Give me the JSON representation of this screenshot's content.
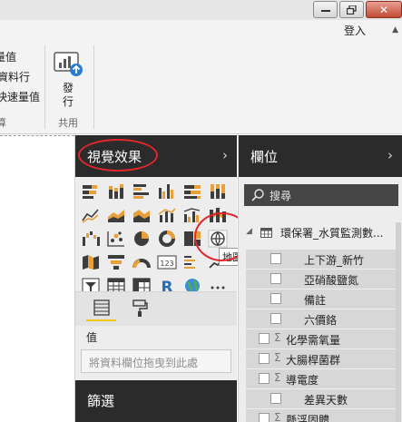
{
  "window": {
    "controls": [
      "minimize",
      "maximize",
      "close"
    ],
    "close_glyph": "✕"
  },
  "ribbon": {
    "signin": "登入",
    "partial_items": [
      "量值",
      "資料行",
      "快速量值"
    ],
    "publish_label": "發行",
    "group_label_left": "算",
    "group_label_share": "共用"
  },
  "visualizations": {
    "title": "視覺效果",
    "chevron": "›",
    "tooltip": "地圖",
    "values_label": "值",
    "drop_placeholder": "將資料欄位拖曳到此處",
    "filter_title": "篩選",
    "icons": [
      "stacked-bar-icon",
      "stacked-column-icon",
      "clustered-bar-icon",
      "clustered-column-icon",
      "100pct-bar-icon",
      "100pct-column-icon",
      "line-chart-icon",
      "area-chart-icon",
      "stacked-area-icon",
      "line-column-icon",
      "line-clustered-column-icon",
      "ribbon-chart-icon",
      "waterfall-icon",
      "scatter-icon",
      "pie-chart-icon",
      "donut-icon",
      "treemap-icon",
      "map-icon",
      "filled-map-icon",
      "funnel-icon",
      "gauge-icon",
      "card-icon",
      "multirow-card-icon",
      "kpi-icon",
      "slicer-icon",
      "table-icon",
      "matrix-icon",
      "r-visual-icon",
      "globe-icon",
      "more-icon"
    ],
    "accent_color": "#f2c811",
    "highlight_color": "#e2262b"
  },
  "fields": {
    "title": "欄位",
    "chevron": "›",
    "search_placeholder": "搜尋",
    "table_name": "環保署_水質監測數...",
    "items": [
      {
        "name": "上下游_新竹",
        "sigma": false
      },
      {
        "name": "亞硝酸鹽氮",
        "sigma": false
      },
      {
        "name": "備註",
        "sigma": false
      },
      {
        "name": "六價鉻",
        "sigma": false
      },
      {
        "name": "化學需氧量",
        "sigma": true
      },
      {
        "name": "大腸桿菌群",
        "sigma": true
      },
      {
        "name": "導電度",
        "sigma": true
      },
      {
        "name": "差異天數",
        "sigma": false
      },
      {
        "name": "懸浮固體",
        "sigma": true
      }
    ]
  }
}
